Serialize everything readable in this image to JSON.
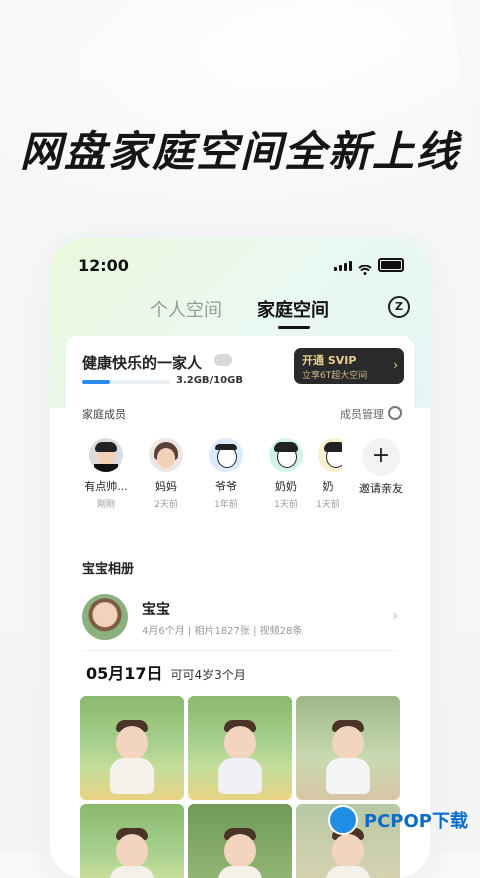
{
  "headline": "网盘家庭空间全新上线",
  "status": {
    "time": "12:00"
  },
  "tabs": [
    {
      "label": "个人空间"
    },
    {
      "label": "家庭空间"
    }
  ],
  "family_card": {
    "name": "健康快乐的一家人",
    "storage_text": "3.2GB/10GB",
    "storage_used_fraction": 0.32,
    "svip": {
      "title": "开通 SVIP",
      "subtitle": "立享6T超大空间",
      "arrow": "›"
    },
    "members_title": "家庭成员",
    "member_mgmt": "成员管理",
    "members": [
      {
        "name": "有点帅...",
        "time": "刚刚"
      },
      {
        "name": "妈妈",
        "time": "2天前"
      },
      {
        "name": "爷爷",
        "time": "1年前"
      },
      {
        "name": "奶奶",
        "time": "1天前"
      },
      {
        "name": "奶",
        "time": "1天前"
      }
    ],
    "invite": {
      "icon": "+",
      "label": "邀请亲友"
    }
  },
  "album": {
    "title": "宝宝相册",
    "baby_name": "宝宝",
    "baby_meta": "4月6个月 | 相片1827张 | 视频28条",
    "chevron": "›",
    "date": "05月17日",
    "age": "可可4岁3个月"
  },
  "watermark": {
    "text": "PCPOP下载"
  },
  "colors": {
    "accent_blue": "#2b8cf0",
    "svip_bg": "#2a2a2a",
    "svip_text": "#e9cf8f"
  }
}
